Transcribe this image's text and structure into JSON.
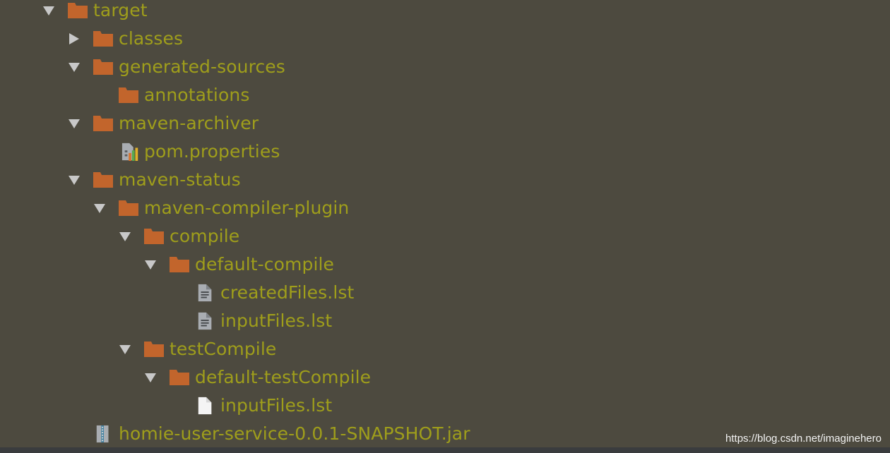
{
  "project_tree": {
    "items": [
      {
        "label": "target",
        "icon": "folder-icon",
        "arrow": "expanded"
      },
      {
        "label": "classes",
        "icon": "folder-icon",
        "arrow": "collapsed"
      },
      {
        "label": "generated-sources",
        "icon": "folder-icon",
        "arrow": "expanded"
      },
      {
        "label": "annotations",
        "icon": "folder-icon",
        "arrow": "none"
      },
      {
        "label": "maven-archiver",
        "icon": "folder-icon",
        "arrow": "expanded"
      },
      {
        "label": "pom.properties",
        "icon": "properties-file-icon",
        "arrow": "none"
      },
      {
        "label": "maven-status",
        "icon": "folder-icon",
        "arrow": "expanded"
      },
      {
        "label": "maven-compiler-plugin",
        "icon": "folder-icon",
        "arrow": "expanded"
      },
      {
        "label": "compile",
        "icon": "folder-icon",
        "arrow": "expanded"
      },
      {
        "label": "default-compile",
        "icon": "folder-icon",
        "arrow": "expanded"
      },
      {
        "label": "createdFiles.lst",
        "icon": "text-file-icon",
        "arrow": "none"
      },
      {
        "label": "inputFiles.lst",
        "icon": "text-file-icon",
        "arrow": "none"
      },
      {
        "label": "testCompile",
        "icon": "folder-icon",
        "arrow": "expanded"
      },
      {
        "label": "default-testCompile",
        "icon": "folder-icon",
        "arrow": "expanded"
      },
      {
        "label": "inputFiles.lst",
        "icon": "blank-file-icon",
        "arrow": "none"
      },
      {
        "label": "homie-user-service-0.0.1-SNAPSHOT.jar",
        "icon": "jar-archive-icon",
        "arrow": "none"
      }
    ]
  },
  "watermark": "https://blog.csdn.net/imaginehero",
  "colors": {
    "background": "#4d4a3f",
    "label": "#9f9e1b",
    "folder": "#c2652c",
    "arrow": "#c8c8c8"
  }
}
